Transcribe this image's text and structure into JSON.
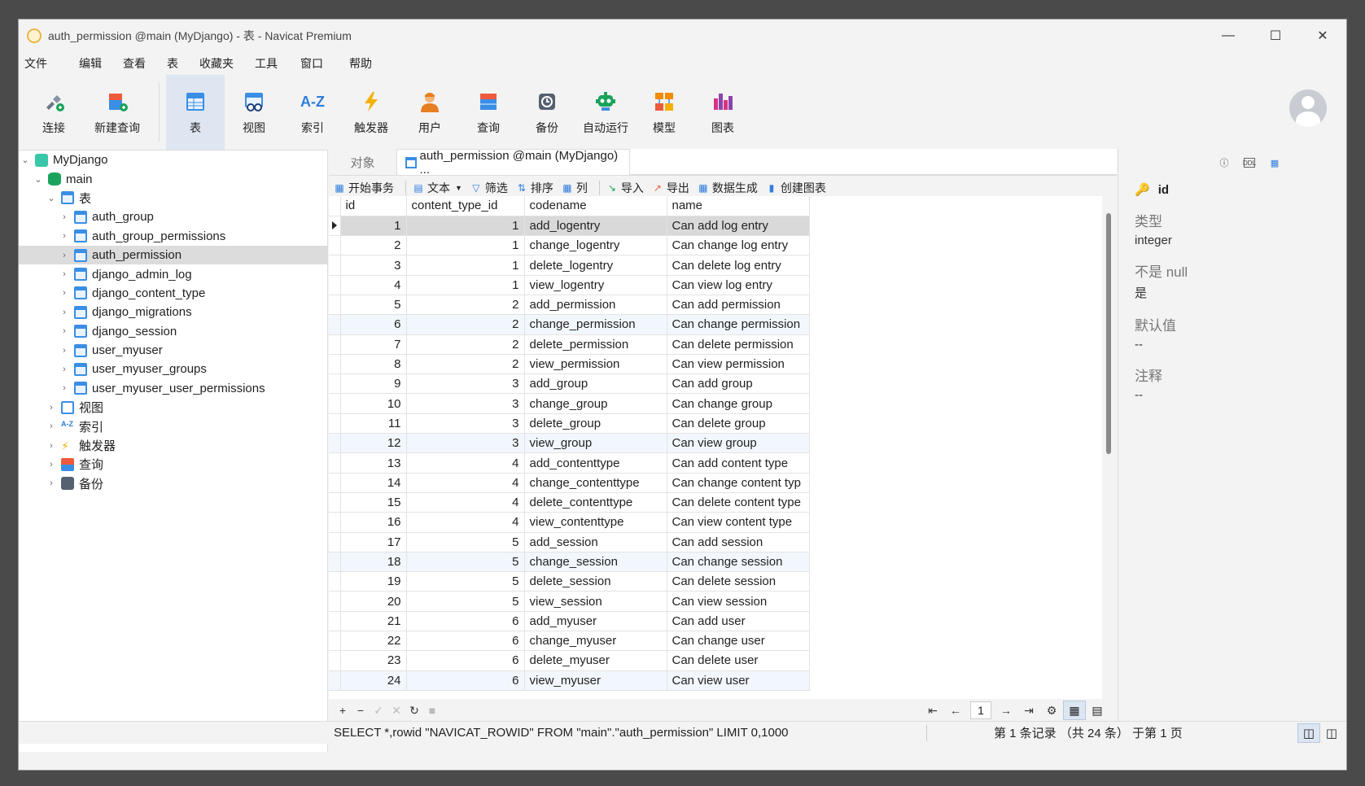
{
  "window": {
    "title": "auth_permission @main (MyDjango) - 表 - Navicat Premium"
  },
  "menu": [
    "文件",
    "编辑",
    "查看",
    "表",
    "收藏夹",
    "工具",
    "窗口",
    "帮助"
  ],
  "toolbar": {
    "connect": "连接",
    "new_query": "新建查询",
    "table": "表",
    "view": "视图",
    "index": "索引",
    "trigger": "触发器",
    "user": "用户",
    "query": "查询",
    "backup": "备份",
    "autorun": "自动运行",
    "model": "模型",
    "chart": "图表",
    "index_glyph": "A-Z"
  },
  "tree": {
    "connection": "MyDjango",
    "database": "main",
    "tables_group": "表",
    "tables": [
      "auth_group",
      "auth_group_permissions",
      "auth_permission",
      "django_admin_log",
      "django_content_type",
      "django_migrations",
      "django_session",
      "user_myuser",
      "user_myuser_groups",
      "user_myuser_user_permissions"
    ],
    "views_group": "视图",
    "indexes_group": "索引",
    "triggers_group": "触发器",
    "queries_group": "查询",
    "backups_group": "备份",
    "index_glyph": "A-Z"
  },
  "tabs": {
    "objects": "对象",
    "active": "auth_permission @main (MyDjango) ..."
  },
  "subtoolbar": {
    "begin_transaction": "开始事务",
    "text": "文本",
    "filter": "筛选",
    "sort": "排序",
    "columns": "列",
    "import": "导入",
    "export": "导出",
    "data_gen": "数据生成",
    "create_chart": "创建图表"
  },
  "grid": {
    "columns": [
      "id",
      "content_type_id",
      "codename",
      "name"
    ],
    "rows": [
      [
        "1",
        "1",
        "add_logentry",
        "Can add log entry"
      ],
      [
        "2",
        "1",
        "change_logentry",
        "Can change log entry"
      ],
      [
        "3",
        "1",
        "delete_logentry",
        "Can delete log entry"
      ],
      [
        "4",
        "1",
        "view_logentry",
        "Can view log entry"
      ],
      [
        "5",
        "2",
        "add_permission",
        "Can add permission"
      ],
      [
        "6",
        "2",
        "change_permission",
        "Can change permission"
      ],
      [
        "7",
        "2",
        "delete_permission",
        "Can delete permission"
      ],
      [
        "8",
        "2",
        "view_permission",
        "Can view permission"
      ],
      [
        "9",
        "3",
        "add_group",
        "Can add group"
      ],
      [
        "10",
        "3",
        "change_group",
        "Can change group"
      ],
      [
        "11",
        "3",
        "delete_group",
        "Can delete group"
      ],
      [
        "12",
        "3",
        "view_group",
        "Can view group"
      ],
      [
        "13",
        "4",
        "add_contenttype",
        "Can add content type"
      ],
      [
        "14",
        "4",
        "change_contenttype",
        "Can change content typ"
      ],
      [
        "15",
        "4",
        "delete_contenttype",
        "Can delete content type"
      ],
      [
        "16",
        "4",
        "view_contenttype",
        "Can view content type"
      ],
      [
        "17",
        "5",
        "add_session",
        "Can add session"
      ],
      [
        "18",
        "5",
        "change_session",
        "Can change session"
      ],
      [
        "19",
        "5",
        "delete_session",
        "Can delete session"
      ],
      [
        "20",
        "5",
        "view_session",
        "Can view session"
      ],
      [
        "21",
        "6",
        "add_myuser",
        "Can add user"
      ],
      [
        "22",
        "6",
        "change_myuser",
        "Can change user"
      ],
      [
        "23",
        "6",
        "delete_myuser",
        "Can delete user"
      ],
      [
        "24",
        "6",
        "view_myuser",
        "Can view user"
      ]
    ],
    "current_row": 0,
    "alt_rows": [
      5,
      11,
      17,
      23
    ]
  },
  "pager": {
    "page": "1"
  },
  "status": {
    "sql": "SELECT *,rowid \"NAVICAT_ROWID\" FROM \"main\".\"auth_permission\" LIMIT 0,1000",
    "records": "第 1 条记录 （共 24 条） 于第 1 页"
  },
  "props": {
    "field": "id",
    "type_label": "类型",
    "type_value": "integer",
    "notnull_label": "不是 null",
    "notnull_value": "是",
    "default_label": "默认值",
    "default_value": "--",
    "comment_label": "注释",
    "comment_value": "--",
    "info_glyph": "ⓘ",
    "ddl_glyph": "DDL"
  },
  "colors": {
    "accent": "#2f7ddd",
    "selected_row": "#d9d9d9",
    "alt_row": "#f2f7fd"
  }
}
